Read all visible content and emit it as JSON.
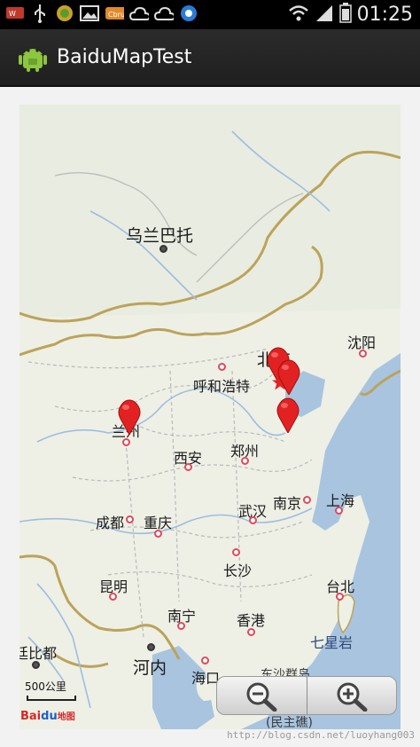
{
  "statusbar": {
    "time": "01:25",
    "left_icons": [
      "notification-icon",
      "usb-icon",
      "app-notification-icon",
      "image-icon",
      "app-badge-icon",
      "cloud-icon",
      "cloud-outline-icon",
      "browser-icon"
    ],
    "right_icons": [
      "wifi-icon",
      "signal-icon",
      "battery-icon"
    ]
  },
  "actionbar": {
    "title": "BaiduMapTest",
    "icon": "android-icon"
  },
  "map": {
    "cities": {
      "ulaanbaatar": "乌兰巴托",
      "shenyang": "沈阳",
      "beijing": "北京",
      "hohhot": "呼和浩特",
      "lanzhou": "兰州",
      "xian": "西安",
      "zhengzhou": "郑州",
      "nanjing": "南京",
      "shanghai": "上海",
      "wuhan": "武汉",
      "chengdu": "成都",
      "chongqing": "重庆",
      "changsha": "长沙",
      "kunming": "昆明",
      "taipei": "台北",
      "nanning": "南宁",
      "hongkong": "香港",
      "qixingyan": "七星岩",
      "thimphu": "廷比都",
      "hanoi": "河内",
      "haikou": "海口",
      "dongsha": "东沙群岛",
      "dongsha_sub": "(民主礁)"
    },
    "scale": "500公里",
    "logo": {
      "brand": "Bai",
      "brand2": "du",
      "suffix": "地图"
    },
    "zoom": {
      "out_icon": "zoom-out-icon",
      "in_icon": "zoom-in-icon"
    }
  },
  "watermark": "http://blog.csdn.net/luoyhang003"
}
